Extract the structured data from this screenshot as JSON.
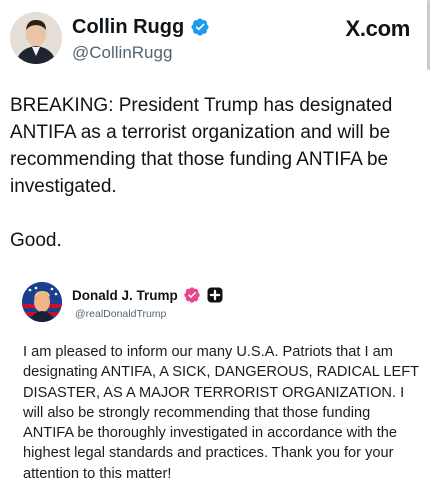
{
  "tweet": {
    "author_name": "Collin Rugg",
    "author_handle": "@CollinRugg",
    "brand": "X.com",
    "text": "BREAKING: President Trump has designated ANTIFA as a terrorist organization and will be recommending that those funding ANTIFA be investigated.",
    "reply": "Good."
  },
  "quote": {
    "author_name": "Donald J. Trump",
    "author_handle": "@realDonaldTrump",
    "text": "I am pleased to inform our many U.S.A. Patriots that I am designating ANTIFA, A SICK, DANGEROUS, RADICAL LEFT DISASTER, AS A MAJOR TERRORIST ORGANIZATION. I will also be strongly recommending that those funding ANTIFA be thoroughly investigated in accordance with the highest legal standards and practices. Thank you for your attention to this matter!"
  },
  "colors": {
    "verified_blue": "#1d9bf0",
    "truth_badge_pink": "#e6478f",
    "handle_gray": "#536471"
  },
  "icons": [
    "verified-badge-icon",
    "truth-verified-icon",
    "plus-square-icon",
    "x-logo"
  ]
}
